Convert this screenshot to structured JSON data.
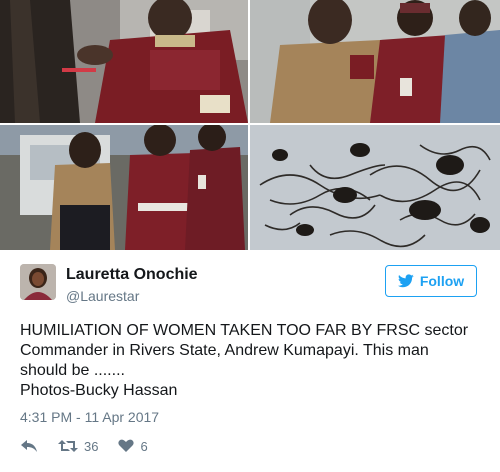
{
  "photos": [
    {
      "alt": "photo-1"
    },
    {
      "alt": "photo-2"
    },
    {
      "alt": "photo-3"
    },
    {
      "alt": "photo-4"
    }
  ],
  "tweet": {
    "author_name": "Lauretta Onochie",
    "author_handle": "@Laurestar",
    "follow_label": "Follow",
    "text_lines": [
      "HUMILIATION OF WOMEN TAKEN TOO FAR BY FRSC sector",
      "Commander in Rivers State, Andrew Kumapayi. This man",
      "should be .......",
      "Photos-Bucky Hassan"
    ],
    "timestamp": "4:31 PM - 11 Apr 2017",
    "retweet_count": "36",
    "like_count": "6"
  },
  "colors": {
    "accent": "#1da1f2",
    "muted": "#657786",
    "text": "#14171a"
  },
  "icons": [
    "twitter-bird-icon",
    "reply-icon",
    "retweet-icon",
    "heart-icon"
  ]
}
